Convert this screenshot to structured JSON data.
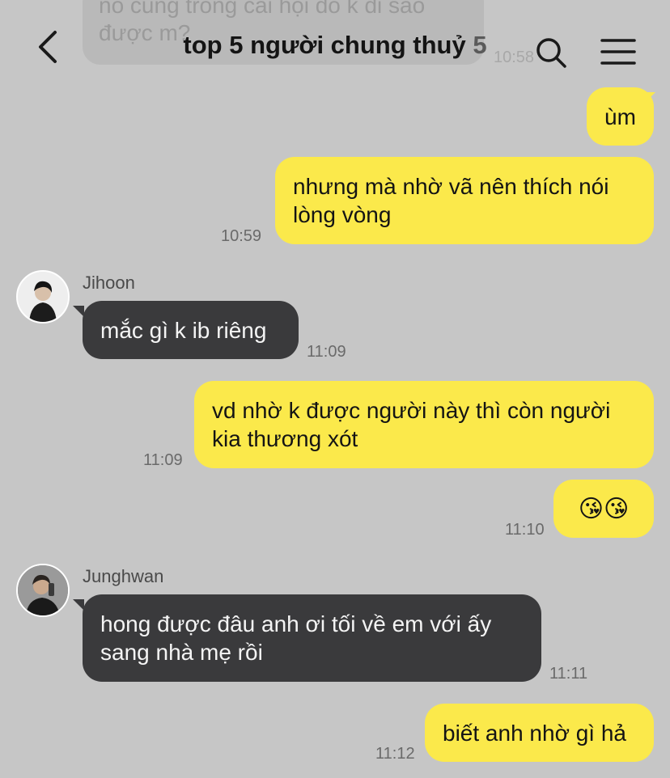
{
  "header": {
    "title": "top 5 người chung thuỷ",
    "member_count": "5",
    "back_icon": "chevron-left-icon",
    "search_icon": "search-icon",
    "menu_icon": "hamburger-menu-icon"
  },
  "faded_previous": {
    "text_line1": "nó cũng trong cái hội đó k đi sao",
    "text_line2": "được m?",
    "time": "10:58"
  },
  "messages": [
    {
      "side": "out",
      "text": "ùm",
      "time": ""
    },
    {
      "side": "out",
      "line1": "nhưng mà nhờ vã nên thích nói",
      "line2": "lòng vòng",
      "time": "10:59"
    },
    {
      "side": "in",
      "sender": "Jihoon",
      "text": "mắc gì k ib riêng",
      "time": "11:09"
    },
    {
      "side": "out",
      "line1": "vd nhờ k được người này thì còn người",
      "line2": "kia thương xót",
      "time": "11:09"
    },
    {
      "side": "out",
      "text": "😘😘",
      "time": "11:10"
    },
    {
      "side": "in",
      "sender": "Junghwan",
      "line1": "hong được đâu anh ơi tối về em với ấy",
      "line2": "sang nhà mẹ rồi",
      "time": "11:11"
    },
    {
      "side": "out",
      "text": "biết anh nhờ gì hả",
      "time": "11:12"
    }
  ],
  "colors": {
    "background": "#c6c6c6",
    "outgoing_bubble": "#fbe94b",
    "incoming_bubble": "#3a3a3c"
  }
}
